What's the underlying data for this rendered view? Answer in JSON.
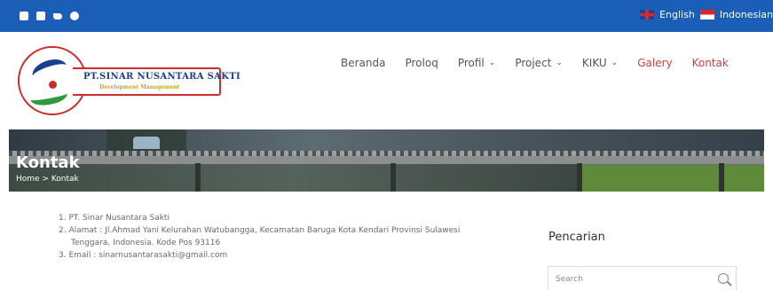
{
  "topbar": {
    "social_icons": [
      "facebook-icon",
      "instagram-icon",
      "twitter-icon",
      "dribbble-icon"
    ],
    "languages": [
      {
        "flag": "uk-flag-icon",
        "label": "English"
      },
      {
        "flag": "indonesia-flag-icon",
        "label": "Indonesian"
      }
    ],
    "bg_color": "#1b5eb8"
  },
  "logo": {
    "name": "PT.SINAR NUSANTARA SAKTI",
    "tagline": "Development Management"
  },
  "nav": {
    "items": [
      {
        "label": "Beranda",
        "dropdown": false
      },
      {
        "label": "Proloq",
        "dropdown": false
      },
      {
        "label": "Profil",
        "dropdown": true
      },
      {
        "label": "Project",
        "dropdown": true
      },
      {
        "label": "KIKU",
        "dropdown": true
      },
      {
        "label": "Galery",
        "dropdown": false,
        "active": true
      },
      {
        "label": "Kontak",
        "dropdown": false,
        "active": true
      }
    ],
    "caret": "⌄",
    "accent_color": "#d43b3b"
  },
  "hero": {
    "title": "Kontak",
    "breadcrumb": "Home  >  Kontak"
  },
  "content": {
    "items": [
      "1. PT. Sinar Nusantara Sakti",
      "2. Alamat : Jl.Ahmad Yani Kelurahan Watubangga, Kecamatan Baruga Kota Kendari Provinsi Sulawesi",
      "Tenggara, Indonesia. Kode Pos 93116",
      "3. Email : sinarnusantarasakti@gmail.com"
    ]
  },
  "sidebar": {
    "title": "Pencarian",
    "search_placeholder": "Search"
  }
}
